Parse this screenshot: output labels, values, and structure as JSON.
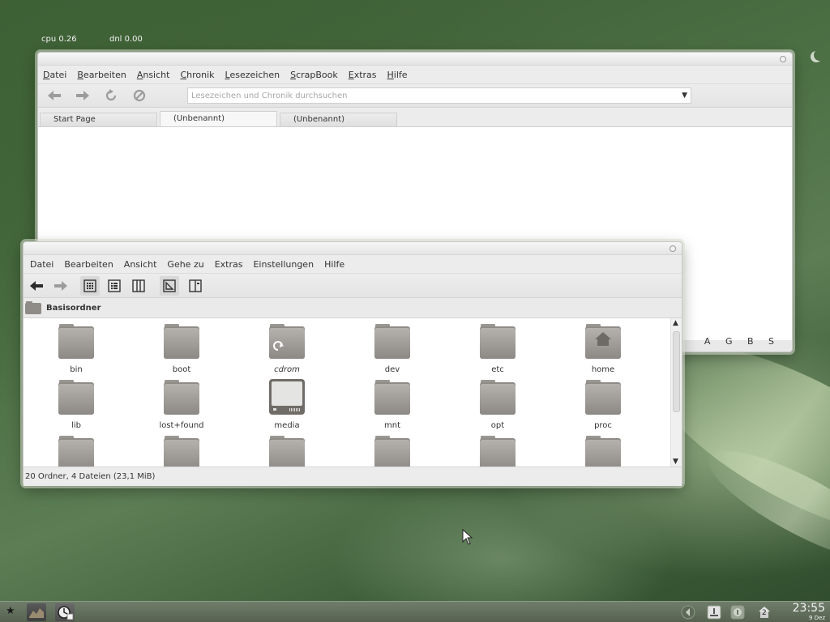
{
  "desktop": {
    "conky": {
      "cpu": "cpu  0.26",
      "dnl": "dnl 0.00"
    }
  },
  "browser": {
    "menu": [
      {
        "acc": "D",
        "rest": "atei"
      },
      {
        "acc": "B",
        "rest": "earbeiten"
      },
      {
        "acc": "A",
        "rest": "nsicht"
      },
      {
        "acc": "C",
        "rest": "hronik"
      },
      {
        "acc": "L",
        "rest": "esezeichen"
      },
      {
        "acc": "S",
        "rest": "crapBook"
      },
      {
        "acc": "E",
        "rest": "xtras"
      },
      {
        "acc": "H",
        "rest": "ilfe"
      }
    ],
    "url_placeholder": "Lesezeichen und Chronik durchsuchen",
    "tabs": [
      "Start Page",
      "(Unbenannt)",
      "(Unbenannt)"
    ],
    "active_tab": 1,
    "page_letters": [
      "A",
      "G",
      "B",
      "S"
    ]
  },
  "filemanager": {
    "menu": [
      "Datei",
      "Bearbeiten",
      "Ansicht",
      "Gehe zu",
      "Extras",
      "Einstellungen",
      "Hilfe"
    ],
    "path": "Basisordner",
    "items": [
      {
        "name": "bin",
        "type": "folder"
      },
      {
        "name": "boot",
        "type": "folder"
      },
      {
        "name": "cdrom",
        "type": "folder-link"
      },
      {
        "name": "dev",
        "type": "folder"
      },
      {
        "name": "etc",
        "type": "folder"
      },
      {
        "name": "home",
        "type": "folder-home"
      },
      {
        "name": "lib",
        "type": "folder"
      },
      {
        "name": "lost+found",
        "type": "folder"
      },
      {
        "name": "media",
        "type": "drive"
      },
      {
        "name": "mnt",
        "type": "folder"
      },
      {
        "name": "opt",
        "type": "folder"
      },
      {
        "name": "proc",
        "type": "folder"
      },
      {
        "name": "",
        "type": "folder"
      },
      {
        "name": "",
        "type": "folder"
      },
      {
        "name": "",
        "type": "folder"
      },
      {
        "name": "",
        "type": "folder"
      },
      {
        "name": "",
        "type": "folder"
      },
      {
        "name": "",
        "type": "folder"
      }
    ],
    "status": "20 Ordner, 4 Dateien (23,1 MiB)"
  },
  "panel": {
    "clock_time": "23:55",
    "clock_date": "9 Dez",
    "tray_badge": "2"
  },
  "colors": {
    "folder_light": "#b5b2ae",
    "folder_dark": "#8c8985",
    "panel": "#5e6a58"
  }
}
